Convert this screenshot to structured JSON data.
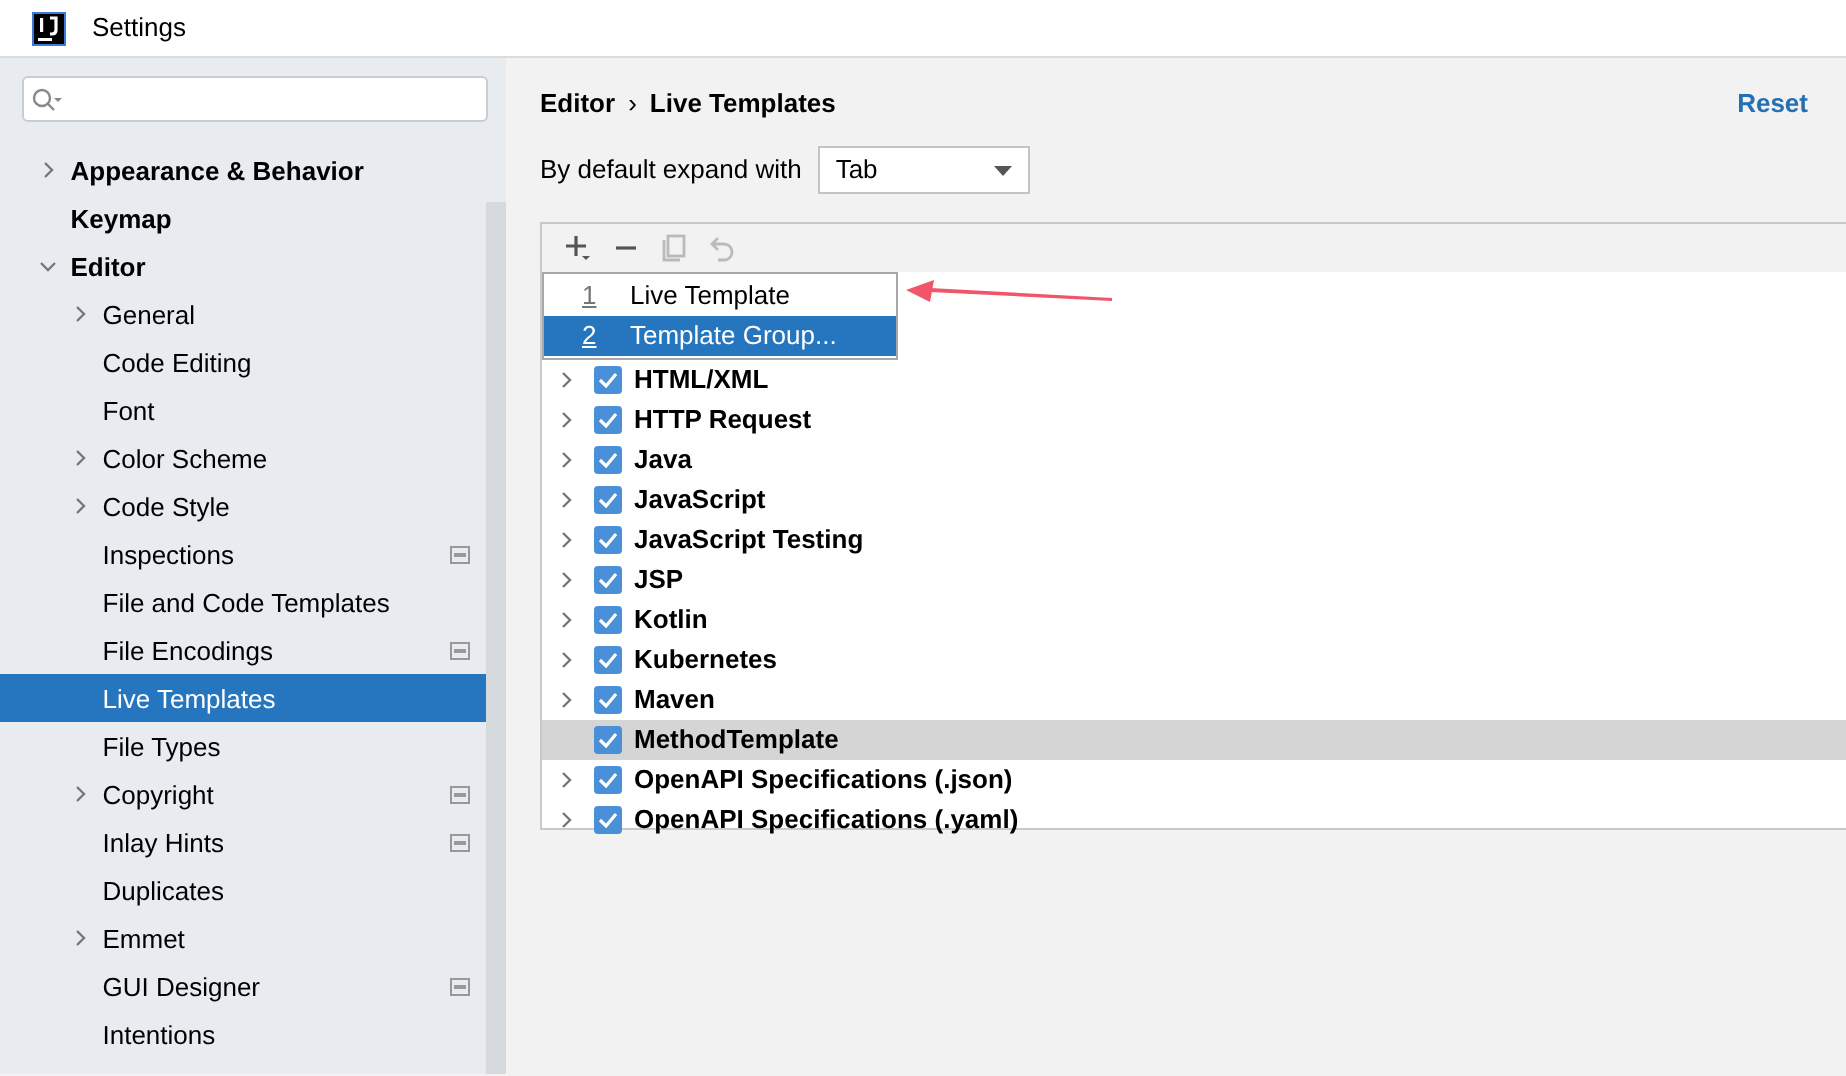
{
  "window": {
    "title": "Settings"
  },
  "sidebar": {
    "items": [
      {
        "label": "Appearance & Behavior",
        "expandable": true,
        "expanded": false,
        "selected": false,
        "scoped": false
      },
      {
        "label": "Keymap",
        "expandable": false,
        "selected": false,
        "scoped": false
      },
      {
        "label": "Editor",
        "expandable": true,
        "expanded": true,
        "selected": false,
        "scoped": false,
        "children": [
          {
            "label": "General",
            "expandable": true,
            "expanded": false,
            "selected": false,
            "scoped": false
          },
          {
            "label": "Code Editing",
            "expandable": false,
            "selected": false,
            "scoped": false
          },
          {
            "label": "Font",
            "expandable": false,
            "selected": false,
            "scoped": false
          },
          {
            "label": "Color Scheme",
            "expandable": true,
            "expanded": false,
            "selected": false,
            "scoped": false
          },
          {
            "label": "Code Style",
            "expandable": true,
            "expanded": false,
            "selected": false,
            "scoped": false
          },
          {
            "label": "Inspections",
            "expandable": false,
            "selected": false,
            "scoped": true
          },
          {
            "label": "File and Code Templates",
            "expandable": false,
            "selected": false,
            "scoped": false
          },
          {
            "label": "File Encodings",
            "expandable": false,
            "selected": false,
            "scoped": true
          },
          {
            "label": "Live Templates",
            "expandable": false,
            "selected": true,
            "scoped": false
          },
          {
            "label": "File Types",
            "expandable": false,
            "selected": false,
            "scoped": false
          },
          {
            "label": "Copyright",
            "expandable": true,
            "expanded": false,
            "selected": false,
            "scoped": true
          },
          {
            "label": "Inlay Hints",
            "expandable": false,
            "selected": false,
            "scoped": true
          },
          {
            "label": "Duplicates",
            "expandable": false,
            "selected": false,
            "scoped": false
          },
          {
            "label": "Emmet",
            "expandable": true,
            "expanded": false,
            "selected": false,
            "scoped": false
          },
          {
            "label": "GUI Designer",
            "expandable": false,
            "selected": false,
            "scoped": true
          },
          {
            "label": "Intentions",
            "expandable": false,
            "selected": false,
            "scoped": false
          }
        ]
      }
    ]
  },
  "breadcrumb": [
    "Editor",
    "Live Templates"
  ],
  "breadcrumb_separator": "›",
  "reset": "Reset",
  "expand_with": {
    "label": "By default expand with",
    "value": "Tab"
  },
  "toolbar": [
    {
      "kind": "add",
      "disabled": false
    },
    {
      "kind": "remove",
      "disabled": false
    },
    {
      "kind": "copy",
      "disabled": true
    },
    {
      "kind": "restore",
      "disabled": true
    }
  ],
  "popup": [
    {
      "mnemonic": "1",
      "label": "Live Template",
      "selected": false
    },
    {
      "mnemonic": "2",
      "label": "Template Group...",
      "selected": true
    }
  ],
  "templates": [
    {
      "label": "HTML/XML",
      "checked": true,
      "expandable": true,
      "selected": false
    },
    {
      "label": "HTTP Request",
      "checked": true,
      "expandable": true,
      "selected": false
    },
    {
      "label": "Java",
      "checked": true,
      "expandable": true,
      "selected": false
    },
    {
      "label": "JavaScript",
      "checked": true,
      "expandable": true,
      "selected": false
    },
    {
      "label": "JavaScript Testing",
      "checked": true,
      "expandable": true,
      "selected": false
    },
    {
      "label": "JSP",
      "checked": true,
      "expandable": true,
      "selected": false
    },
    {
      "label": "Kotlin",
      "checked": true,
      "expandable": true,
      "selected": false
    },
    {
      "label": "Kubernetes",
      "checked": true,
      "expandable": true,
      "selected": false
    },
    {
      "label": "Maven",
      "checked": true,
      "expandable": true,
      "selected": false
    },
    {
      "label": "MethodTemplate",
      "checked": true,
      "expandable": false,
      "selected": true
    },
    {
      "label": "OpenAPI Specifications (.json)",
      "checked": true,
      "expandable": true,
      "selected": false
    },
    {
      "label": "OpenAPI Specifications (.yaml)",
      "checked": true,
      "expandable": true,
      "selected": false
    }
  ]
}
